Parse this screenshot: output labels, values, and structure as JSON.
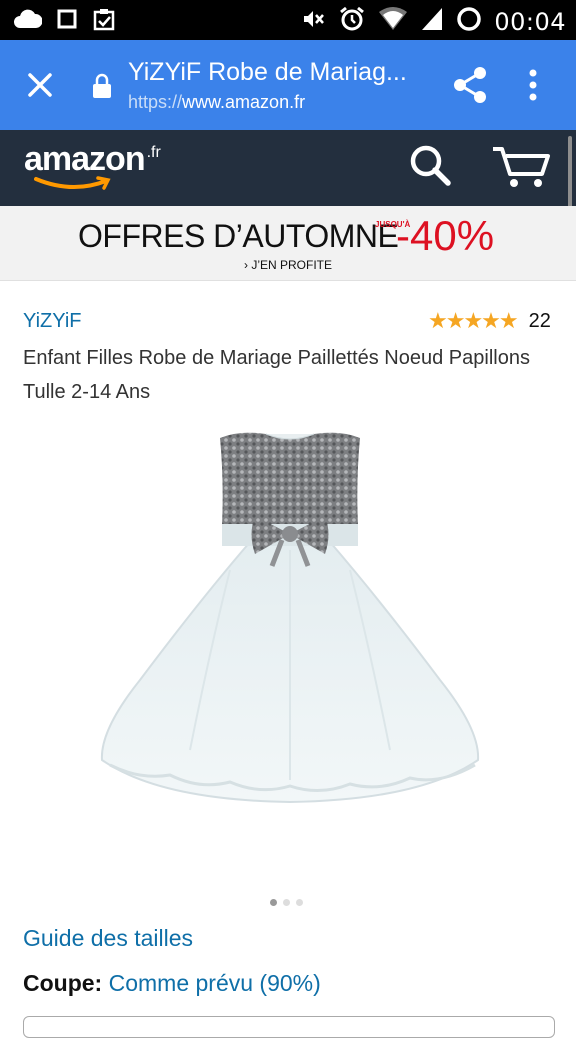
{
  "status_bar": {
    "time": "00:04",
    "icons": [
      "cloud-icon",
      "square-icon",
      "clipboard-check-icon",
      "mute-icon",
      "alarm-icon",
      "wifi-icon",
      "signal-icon",
      "battery-icon"
    ]
  },
  "browser": {
    "title": "YiZYiF Robe de Mariag...",
    "url_scheme": "https://",
    "url_host": "www.amazon.fr",
    "accent": "#3b82ea"
  },
  "amazon": {
    "logo_word": "amazon",
    "logo_tld": ".fr",
    "header_color": "#232f3e"
  },
  "banner": {
    "headline": "OFFRES D’AUTOMNE",
    "upto": "JUSQU'À",
    "percent": "-40%",
    "cta": "› J’EN PROFITE"
  },
  "product": {
    "brand": "YiZYiF",
    "stars": "★★★★★",
    "rating_value": 4.5,
    "rating_count": "22",
    "title": "Enfant Filles Robe de Mariage Paillettés Noeud Papillons Tulle 2-14 Ans",
    "image_count": 3,
    "active_image": 1
  },
  "details": {
    "size_guide": "Guide des tailles",
    "fit_label": "Coupe:",
    "fit_value": "Comme prévu (90%)"
  }
}
